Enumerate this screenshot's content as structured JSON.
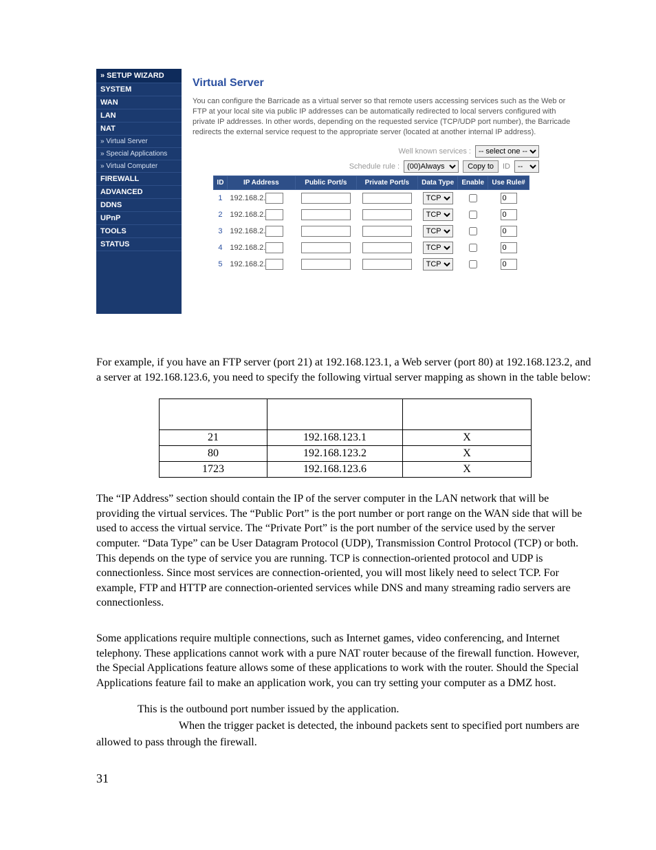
{
  "sidebar": {
    "wizard": "» SETUP WIZARD",
    "items": [
      {
        "label": "SYSTEM"
      },
      {
        "label": "WAN"
      },
      {
        "label": "LAN"
      },
      {
        "label": "NAT"
      },
      {
        "label": "» Virtual Server",
        "sub": true
      },
      {
        "label": "» Special Applications",
        "sub": true
      },
      {
        "label": "» Virtual Computer",
        "sub": true
      },
      {
        "label": "FIREWALL"
      },
      {
        "label": "ADVANCED"
      },
      {
        "label": "DDNS"
      },
      {
        "label": "UPnP"
      },
      {
        "label": "TOOLS"
      },
      {
        "label": "STATUS"
      }
    ]
  },
  "content": {
    "title": "Virtual Server",
    "desc": "You can configure the Barricade as a virtual server so that remote users accessing services such as the Web or FTP at your local site via public IP addresses can be automatically redirected to local servers configured with private IP addresses. In other words, depending on the requested service (TCP/UDP port number), the Barricade redirects the external service request to the appropriate server (located at another internal IP address).",
    "filters": {
      "wks_label": "Well known services :",
      "wks_value": "-- select one --",
      "sched_label": "Schedule rule :",
      "sched_value": "(00)Always",
      "copy_btn": "Copy to",
      "copy_id_label": "ID",
      "copy_id_value": "--"
    },
    "table": {
      "headers": {
        "id": "ID",
        "ip": "IP Address",
        "pub": "Public Port/s",
        "priv": "Private Port/s",
        "dtype": "Data Type",
        "enable": "Enable",
        "rule": "Use Rule#"
      },
      "ip_prefix": "192.168.2.",
      "rows": [
        {
          "id": "1",
          "ip": "",
          "pub": "",
          "priv": "",
          "data_type": "TCP",
          "enable": false,
          "rule": "0"
        },
        {
          "id": "2",
          "ip": "",
          "pub": "",
          "priv": "",
          "data_type": "TCP",
          "enable": false,
          "rule": "0"
        },
        {
          "id": "3",
          "ip": "",
          "pub": "",
          "priv": "",
          "data_type": "TCP",
          "enable": false,
          "rule": "0"
        },
        {
          "id": "4",
          "ip": "",
          "pub": "",
          "priv": "",
          "data_type": "TCP",
          "enable": false,
          "rule": "0"
        },
        {
          "id": "5",
          "ip": "",
          "pub": "",
          "priv": "",
          "data_type": "TCP",
          "enable": false,
          "rule": "0"
        }
      ]
    }
  },
  "doc": {
    "para1": "For example, if you have an FTP server (port 21) at 192.168.123.1, a Web server (port 80) at 192.168.123.2, and a server at 192.168.123.6, you need to specify the following virtual server mapping as shown in the table below:",
    "table": {
      "headers": {
        "a": "",
        "b": "",
        "c": ""
      },
      "rows": [
        {
          "a": "21",
          "b": "192.168.123.1",
          "c": "X"
        },
        {
          "a": "80",
          "b": "192.168.123.2",
          "c": "X"
        },
        {
          "a": "1723",
          "b": "192.168.123.6",
          "c": "X"
        }
      ]
    },
    "para2": "The “IP Address” section should contain the IP of the server computer in the LAN network that will be providing the virtual services. The “Public Port” is the port number or port range on the WAN side that will be used to access the virtual service. The “Private Port” is the port number of the service used by the server computer. “Data Type” can be User Datagram Protocol (UDP), Transmission Control Protocol (TCP) or both. This depends on the type of service you are running. TCP is connection-oriented protocol and UDP is connectionless. Since most services are connection-oriented, you will most likely need to select TCP. For example, FTP and HTTP are connection-oriented services while DNS and many streaming radio servers are connectionless.",
    "para3": "Some applications require multiple connections, such as Internet games, video conferencing, and Internet telephony. These applications cannot work with a pure NAT router because of the firewall function. However, the Special Applications feature allows some of these applications to work with the router. Should the Special Applications feature fail to make an application work, you can try setting your computer as a DMZ host.",
    "def1_text": "This is the outbound port number issued by the application.",
    "def2_text": "When the trigger packet is detected, the inbound packets sent to specified port numbers are allowed to pass through the firewall.",
    "page_num": "31"
  }
}
